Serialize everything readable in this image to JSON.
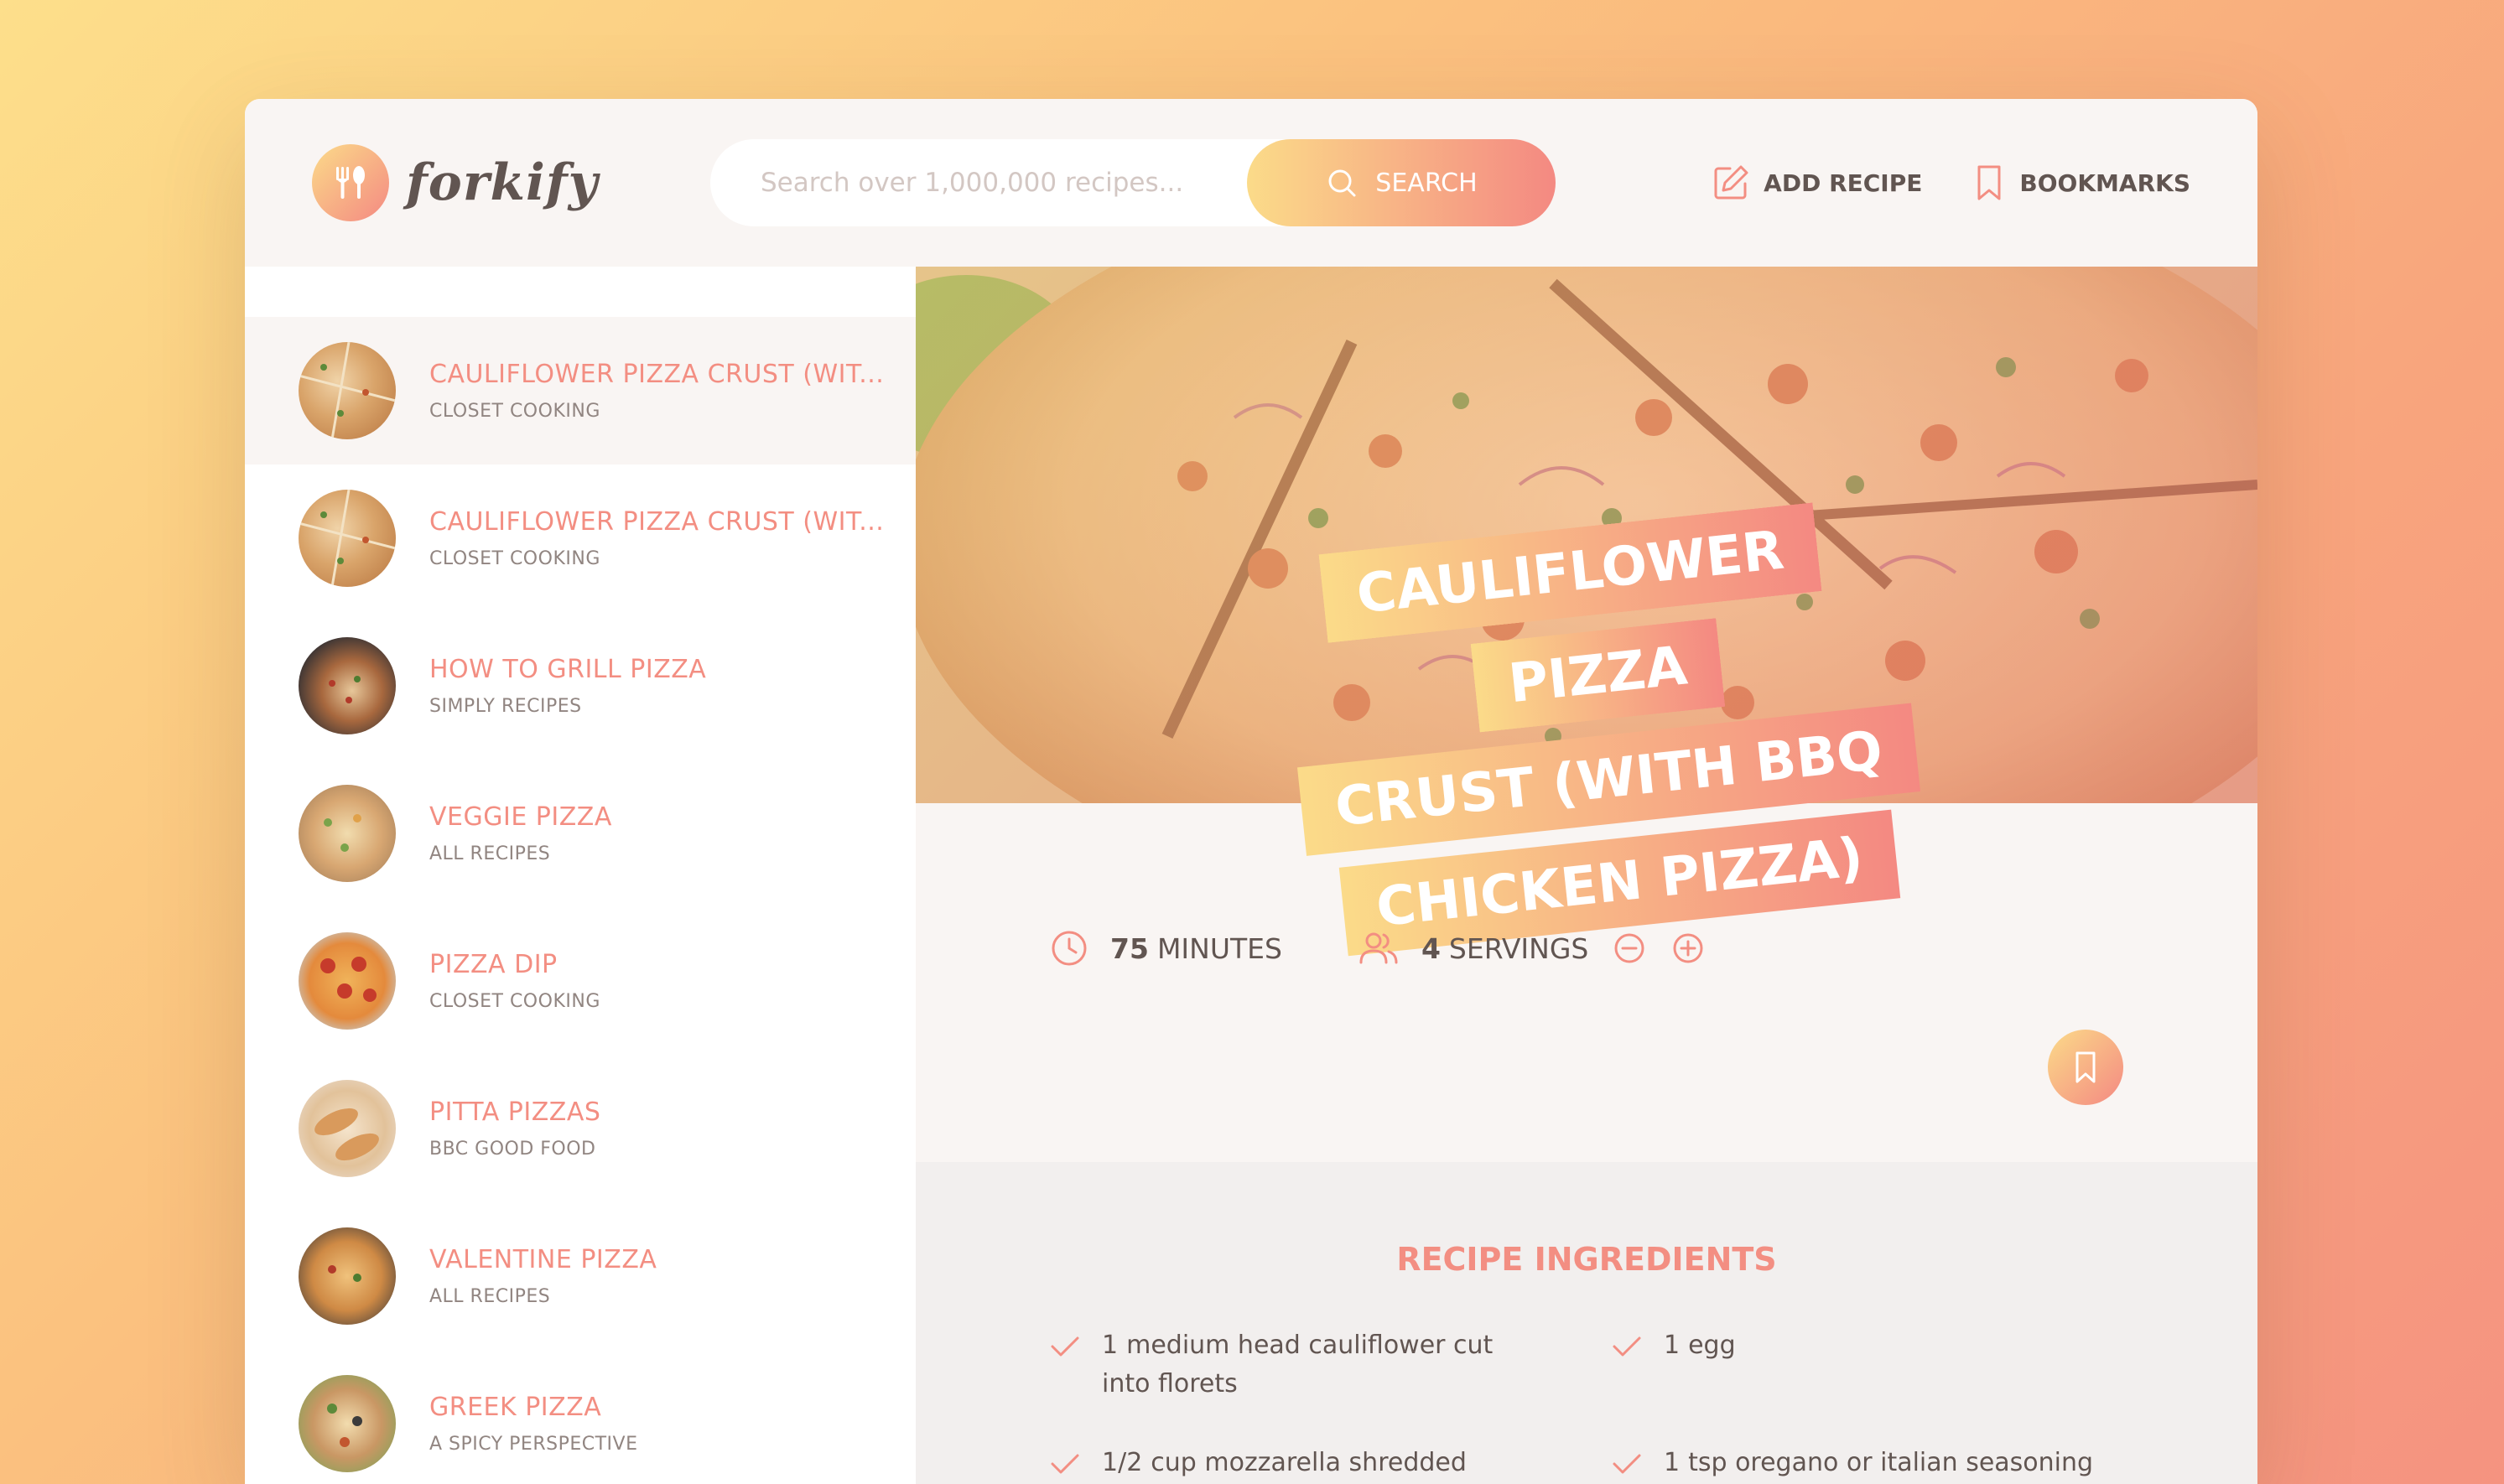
{
  "app": {
    "logo_text": "forkify"
  },
  "search": {
    "placeholder": "Search over 1,000,000 recipes...",
    "button_label": "SEARCH"
  },
  "nav": {
    "add_recipe": "ADD RECIPE",
    "bookmarks": "BOOKMARKS"
  },
  "results": [
    {
      "title": "CAULIFLOWER PIZZA CRUST (WIT...",
      "publisher": "CLOSET COOKING",
      "active": true
    },
    {
      "title": "CAULIFLOWER PIZZA CRUST (WIT...",
      "publisher": "CLOSET COOKING",
      "active": false
    },
    {
      "title": "HOW TO GRILL PIZZA",
      "publisher": "SIMPLY RECIPES",
      "active": false
    },
    {
      "title": "VEGGIE PIZZA",
      "publisher": "ALL RECIPES",
      "active": false
    },
    {
      "title": "PIZZA DIP",
      "publisher": "CLOSET COOKING",
      "active": false
    },
    {
      "title": "PITTA PIZZAS",
      "publisher": "BBC GOOD FOOD",
      "active": false
    },
    {
      "title": "VALENTINE PIZZA",
      "publisher": "ALL RECIPES",
      "active": false
    },
    {
      "title": "GREEK PIZZA",
      "publisher": "A SPICY PERSPECTIVE",
      "active": false
    }
  ],
  "recipe": {
    "title_lines": [
      "CAULIFLOWER PIZZA",
      "CRUST (WITH BBQ",
      "CHICKEN PIZZA)"
    ],
    "minutes": "75",
    "minutes_label": "MINUTES",
    "servings": "4",
    "servings_label": "SERVINGS",
    "ingredients_heading": "RECIPE INGREDIENTS",
    "ingredients": [
      {
        "quantity": "1",
        "description": "medium head cauliflower cut into florets"
      },
      {
        "quantity": "1",
        "description": "egg"
      },
      {
        "quantity": "1/2",
        "description": "cup mozzarella shredded"
      },
      {
        "quantity": "1",
        "description": "tsp oregano or italian seasoning blend"
      }
    ]
  },
  "colors": {
    "accent": "#f38e82",
    "gradient_start": "#fbdb89",
    "gradient_end": "#f48982",
    "text": "#615551",
    "muted": "#918581",
    "panel": "#f9f5f3"
  }
}
